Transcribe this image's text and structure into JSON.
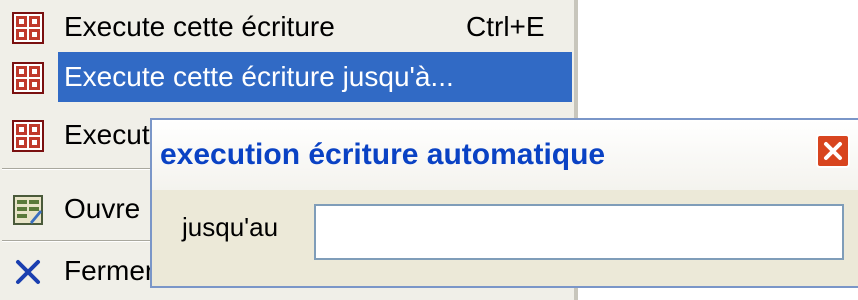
{
  "menu": {
    "items": [
      {
        "label": "Execute cette écriture",
        "shortcut": "Ctrl+E",
        "icon": "calculator-icon"
      },
      {
        "label": "Execute cette écriture jusqu'à...",
        "shortcut": "",
        "icon": "calculator-icon"
      },
      {
        "label": "Execut",
        "shortcut": "",
        "icon": "calculator-icon"
      },
      {
        "label": "Ouvre",
        "shortcut": "",
        "icon": "form-icon"
      },
      {
        "label": "Fermer",
        "shortcut": "",
        "icon": "close-x-icon"
      }
    ]
  },
  "dialog": {
    "title": "execution écriture automatique",
    "field_label": "jusqu'au",
    "field_value": ""
  },
  "colors": {
    "selection": "#316ac5",
    "title_text": "#0a42c4",
    "close_button": "#d8451f"
  }
}
